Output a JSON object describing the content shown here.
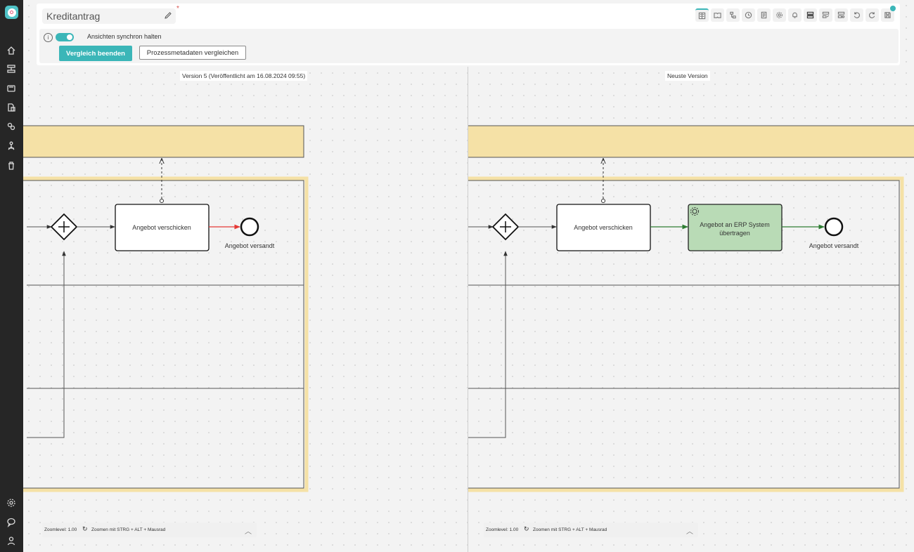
{
  "app": {
    "logo": "process-app-logo"
  },
  "sidebar": {
    "top_icons": [
      "home-icon",
      "process-list-icon",
      "monitor-icon",
      "documents-icon",
      "link-icon",
      "org-chart-icon",
      "trash-icon"
    ],
    "bottom_icons": [
      "settings-icon",
      "chat-icon",
      "user-icon"
    ]
  },
  "header": {
    "title": "Kreditantrag",
    "unsaved_marker": "*",
    "toolbar_icons": [
      "compare-icon",
      "book-icon",
      "hierarchy-icon",
      "clock-icon",
      "document-icon",
      "gear-icon",
      "bell-icon",
      "layout-icon",
      "layout-edit-icon",
      "layout-settings-icon",
      "undo-icon",
      "redo-icon",
      "save-icon"
    ]
  },
  "compare_options": {
    "info": "i",
    "sync_label": "Ansichten synchron halten",
    "sync_on": true,
    "end_button": "Vergleich beenden",
    "metadata_button": "Prozessmetadaten vergleichen"
  },
  "left_view": {
    "version_label": "Version 5 (Veröffentlicht am 16.08.2024 09:55)",
    "task_label": "Angebot verschicken",
    "end_event_label": "Angebot versandt",
    "zoom_label": "Zoomlevel: 1.00",
    "zoom_hint": "Zoomen mit STRG + ALT + Mausrad"
  },
  "right_view": {
    "version_label": "Neuste Version",
    "task_label": "Angebot verschicken",
    "new_task_line1": "Angebot an ERP System",
    "new_task_line2": "übertragen",
    "end_event_label": "Angebot versandt",
    "zoom_label": "Zoomlevel: 1.00",
    "zoom_hint": "Zoomen mit STRG + ALT + Mausrad"
  },
  "colors": {
    "accent": "#3bb6b8",
    "added_fill": "#b9dbb6",
    "added_stroke": "#2e7d32",
    "removed_stroke": "#e53935",
    "pool_fill": "#f5e1a6",
    "sidebar_bg": "#262626"
  }
}
